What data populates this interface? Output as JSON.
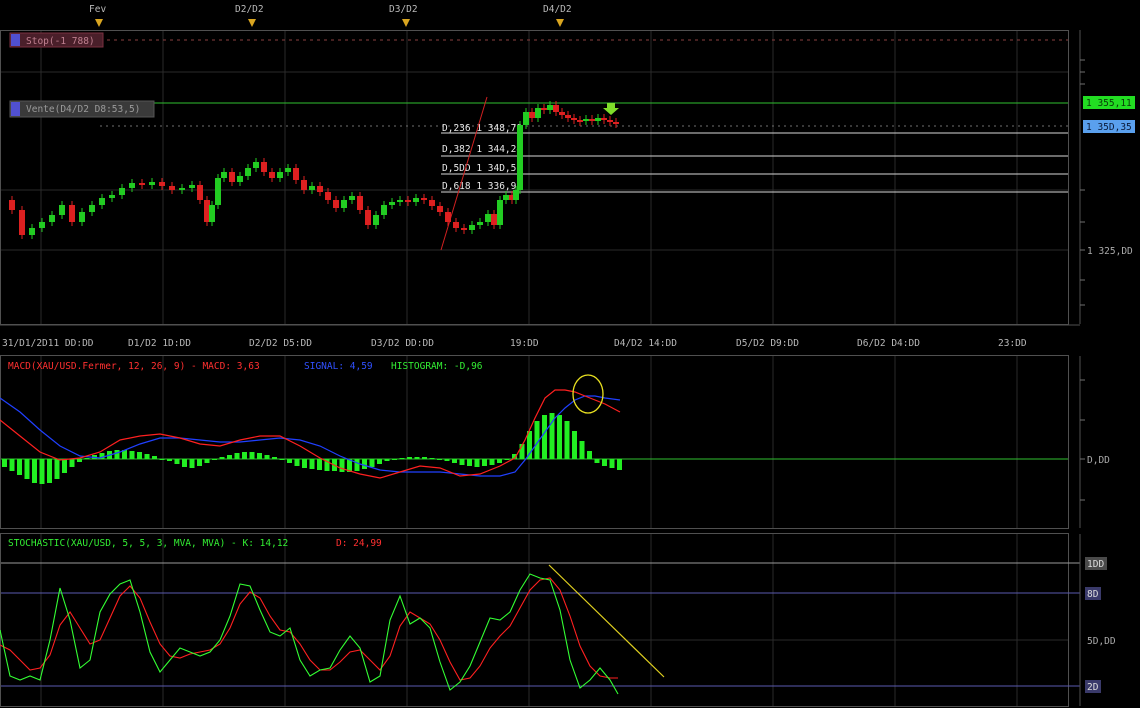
{
  "date_markers": [
    "Fev",
    "D2/D2",
    "D3/D2",
    "D4/D2"
  ],
  "time_axis": [
    "31/D1/2D11 DD:DD",
    "D1/D2 1D:DD",
    "D2/D2 D5:DD",
    "D3/D2 DD:DD",
    "19:DD",
    "D4/D2 14:DD",
    "D5/D2 D9:DD",
    "D6/D2 D4:DD",
    "23:DD"
  ],
  "orders": {
    "stop_label": "Stop(-1 788)",
    "sell_label": "Vente(D4/D2 D8:53,5)"
  },
  "price_axis": {
    "current_price": "1 355,11",
    "bid_price": "1 35D,35",
    "level_label": "1 325,DD",
    "current_color": "#33ff33",
    "bid_color": "#66aaff"
  },
  "fib_levels": [
    {
      "label": "D,236 1 348,78"
    },
    {
      "label": "D,382 1 344,24"
    },
    {
      "label": "D,5DD 1 34D,57"
    },
    {
      "label": "D,618 1 336,9D"
    }
  ],
  "macd": {
    "title": "MACD(XAU/USD.Fermer, 12, 26, 9) - MACD: 3,63",
    "signal": "SIGNAL: 4,59",
    "histogram": "HISTOGRAM: -D,96",
    "zero_label": "D,DD",
    "macd_color": "#ff2020",
    "signal_color": "#2040ff",
    "hist_color": "#22ee22"
  },
  "stochastic": {
    "title": "STOCHASTIC(XAU/USD, 5, 5, 3, MVA, MVA) -  K: 14,12",
    "d_label": "D: 24,99",
    "levels": [
      "1DD",
      "8D",
      "5D,DD",
      "2D"
    ],
    "k_color": "#33ff33",
    "d_color": "#ff2020"
  },
  "chart_data": [
    {
      "type": "line",
      "title": "XAU/USD candlestick",
      "price_levels": [
        1355.11,
        1350.35,
        1348.78,
        1344.24,
        1340.57,
        1336.9,
        1325.0
      ],
      "stop_value": -1788
    },
    {
      "type": "bar",
      "title": "MACD",
      "macd": 3.63,
      "signal": 4.59,
      "histogram": -0.96
    },
    {
      "type": "line",
      "title": "Stochastic",
      "k": 14.12,
      "d": 24.99,
      "levels": [
        100,
        80,
        50,
        20
      ]
    }
  ]
}
